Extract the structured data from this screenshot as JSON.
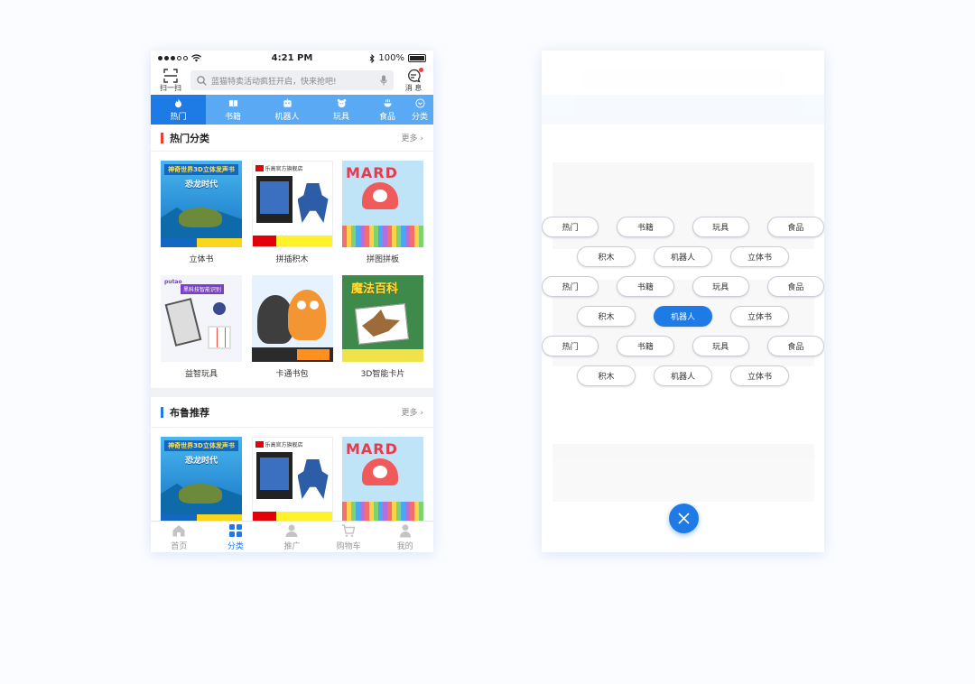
{
  "status": {
    "time": "4:21 PM",
    "battery": "100%"
  },
  "header": {
    "scan_label": "扫一扫",
    "search_placeholder": "蓝猫特卖活动疯狂开启，快来抢吧!",
    "msg_label": "消 息"
  },
  "catnav": {
    "items": [
      {
        "label": "热门",
        "icon": "fire-icon",
        "active": true
      },
      {
        "label": "书籍",
        "icon": "book-icon"
      },
      {
        "label": "机器人",
        "icon": "robot-icon"
      },
      {
        "label": "玩具",
        "icon": "toy-icon"
      },
      {
        "label": "食品",
        "icon": "food-icon"
      },
      {
        "label": "分类",
        "icon": "chevron-down-icon"
      }
    ]
  },
  "section1": {
    "title": "热门分类",
    "more": "更多 ›",
    "accent": "#e8402f",
    "items": [
      {
        "label": "立体书",
        "thumb": "t-book"
      },
      {
        "label": "拼插积木",
        "thumb": "t-lego"
      },
      {
        "label": "拼图拼板",
        "thumb": "t-mard"
      },
      {
        "label": "益智玩具",
        "thumb": "t-puz"
      },
      {
        "label": "卡通书包",
        "thumb": "t-bag"
      },
      {
        "label": "3D智能卡片",
        "thumb": "t-3d"
      }
    ]
  },
  "section2": {
    "title": "布鲁推荐",
    "more": "更多 ›",
    "accent": "#1e7be6"
  },
  "tabbar": [
    {
      "label": "首页",
      "icon": "home-icon"
    },
    {
      "label": "分类",
      "icon": "grid-icon",
      "active": true
    },
    {
      "label": "推广",
      "icon": "promote-icon"
    },
    {
      "label": "购物车",
      "icon": "cart-icon"
    },
    {
      "label": "我的",
      "icon": "user-icon"
    }
  ],
  "thumb_text": {
    "book_h1": "神奇世界3D立体发声书",
    "book_h2": "恐龙时代",
    "lego_brand": "乐高官方旗舰店",
    "mard_word": "MARD",
    "puz_brand": "putao",
    "puz_tag": "黑科技智能识别",
    "t3d_title": "魔法百科"
  },
  "filter_overlay": {
    "rows": [
      [
        "热门",
        "书籍",
        "玩具",
        "食品"
      ],
      [
        "积木",
        "机器人",
        "立体书"
      ],
      [
        "热门",
        "书籍",
        "玩具",
        "食品"
      ],
      [
        "积木",
        "机器人",
        "立体书"
      ],
      [
        "热门",
        "书籍",
        "玩具",
        "食品"
      ],
      [
        "积木",
        "机器人",
        "立体书"
      ]
    ],
    "active_row": 3,
    "active_index": 1,
    "accent": "#1e7be6"
  }
}
